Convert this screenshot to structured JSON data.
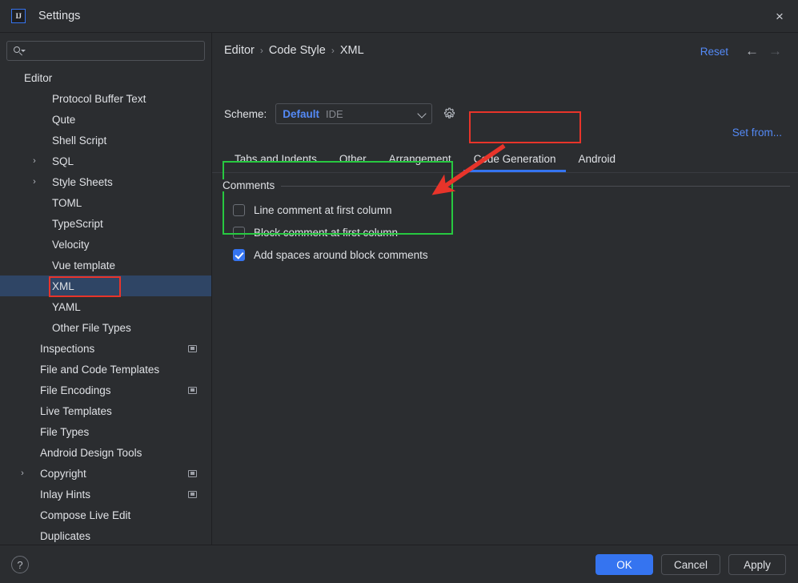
{
  "window": {
    "title": "Settings",
    "logo_text": "IJ",
    "close_icon": "×"
  },
  "colors": {
    "accent": "#3574f0",
    "link": "#548af7",
    "selection": "#2f4565",
    "background": "#2b2d30",
    "annotation_red": "#e8342a",
    "annotation_green": "#27c840"
  },
  "search": {
    "value": "",
    "placeholder": ""
  },
  "sidebar": {
    "items": [
      {
        "label": "Editor",
        "indent": 30,
        "arrow": "",
        "badge": false,
        "selected": false
      },
      {
        "label": "Protocol Buffer Text",
        "indent": 65,
        "arrow": "",
        "badge": false,
        "selected": false
      },
      {
        "label": "Qute",
        "indent": 65,
        "arrow": "",
        "badge": false,
        "selected": false
      },
      {
        "label": "Shell Script",
        "indent": 65,
        "arrow": "",
        "badge": false,
        "selected": false
      },
      {
        "label": "SQL",
        "indent": 65,
        "arrow": "›",
        "badge": false,
        "selected": false
      },
      {
        "label": "Style Sheets",
        "indent": 65,
        "arrow": "›",
        "badge": false,
        "selected": false
      },
      {
        "label": "TOML",
        "indent": 65,
        "arrow": "",
        "badge": false,
        "selected": false
      },
      {
        "label": "TypeScript",
        "indent": 65,
        "arrow": "",
        "badge": false,
        "selected": false
      },
      {
        "label": "Velocity",
        "indent": 65,
        "arrow": "",
        "badge": false,
        "selected": false
      },
      {
        "label": "Vue template",
        "indent": 65,
        "arrow": "",
        "badge": false,
        "selected": false
      },
      {
        "label": "XML",
        "indent": 65,
        "arrow": "",
        "badge": false,
        "selected": true
      },
      {
        "label": "YAML",
        "indent": 65,
        "arrow": "",
        "badge": false,
        "selected": false
      },
      {
        "label": "Other File Types",
        "indent": 65,
        "arrow": "",
        "badge": false,
        "selected": false
      },
      {
        "label": "Inspections",
        "indent": 50,
        "arrow": "",
        "badge": true,
        "selected": false
      },
      {
        "label": "File and Code Templates",
        "indent": 50,
        "arrow": "",
        "badge": false,
        "selected": false
      },
      {
        "label": "File Encodings",
        "indent": 50,
        "arrow": "",
        "badge": true,
        "selected": false
      },
      {
        "label": "Live Templates",
        "indent": 50,
        "arrow": "",
        "badge": false,
        "selected": false
      },
      {
        "label": "File Types",
        "indent": 50,
        "arrow": "",
        "badge": false,
        "selected": false
      },
      {
        "label": "Android Design Tools",
        "indent": 50,
        "arrow": "",
        "badge": false,
        "selected": false
      },
      {
        "label": "Copyright",
        "indent": 50,
        "arrow": "›",
        "badge": true,
        "selected": false
      },
      {
        "label": "Inlay Hints",
        "indent": 50,
        "arrow": "",
        "badge": true,
        "selected": false
      },
      {
        "label": "Compose Live Edit",
        "indent": 50,
        "arrow": "",
        "badge": false,
        "selected": false
      },
      {
        "label": "Duplicates",
        "indent": 50,
        "arrow": "",
        "badge": false,
        "selected": false
      }
    ]
  },
  "header": {
    "breadcrumb": [
      "Editor",
      "Code Style",
      "XML"
    ],
    "separator": "›",
    "reset_label": "Reset",
    "back_icon": "←",
    "forward_icon": "→"
  },
  "scheme": {
    "label": "Scheme:",
    "value": "Default",
    "scope": "IDE",
    "set_from_label": "Set from..."
  },
  "tabs": [
    {
      "label": "Tabs and Indents",
      "active": false
    },
    {
      "label": "Other",
      "active": false
    },
    {
      "label": "Arrangement",
      "active": false
    },
    {
      "label": "Code Generation",
      "active": true
    },
    {
      "label": "Android",
      "active": false
    }
  ],
  "comments_group": {
    "title": "Comments",
    "options": [
      {
        "label": "Line comment at first column",
        "checked": false
      },
      {
        "label": "Block comment at first column",
        "checked": false
      },
      {
        "label": "Add spaces around block comments",
        "checked": true
      }
    ]
  },
  "footer": {
    "help_icon": "?",
    "buttons": [
      {
        "label": "OK",
        "style": "primary"
      },
      {
        "label": "Cancel",
        "style": "normal"
      },
      {
        "label": "Apply",
        "style": "normal"
      }
    ]
  }
}
